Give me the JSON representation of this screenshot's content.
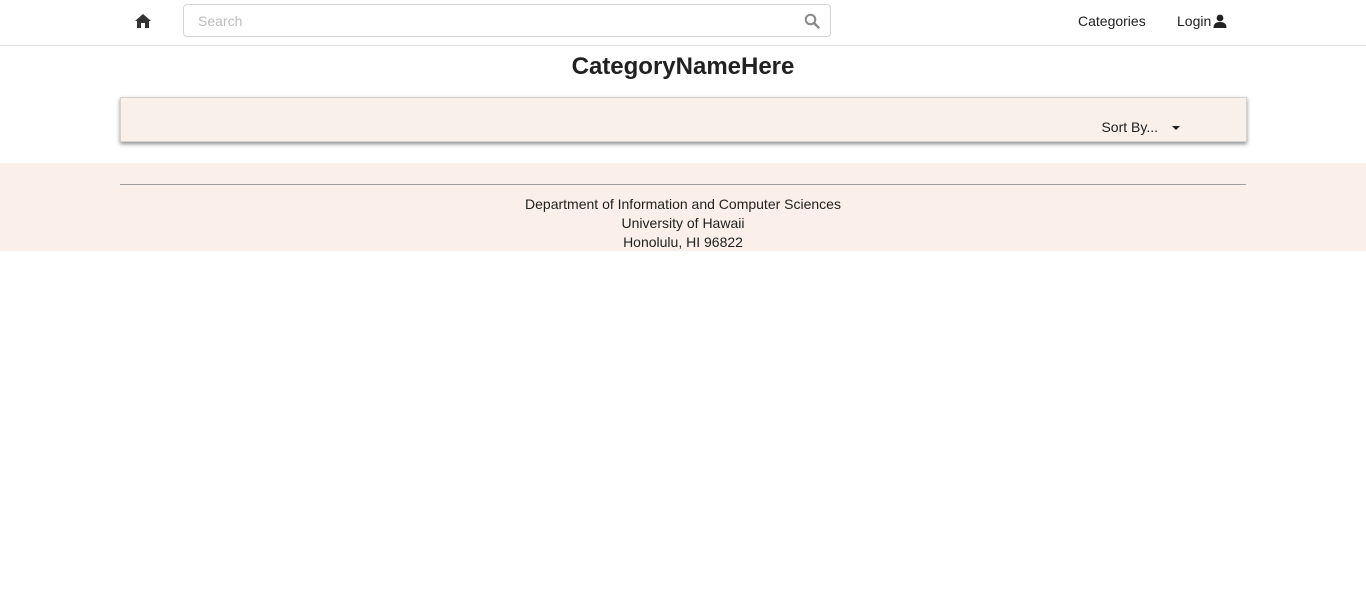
{
  "header": {
    "home_icon": "home-icon",
    "search": {
      "placeholder": "Search",
      "value": "",
      "icon": "search-icon"
    },
    "nav": {
      "categories_label": "Categories",
      "login_label": "Login",
      "login_icon": "user-icon"
    }
  },
  "main": {
    "title": "CategoryNameHere",
    "sort": {
      "label": "Sort By...",
      "icon": "caret-down-icon"
    }
  },
  "footer": {
    "line1": "Department of Information and Computer Sciences",
    "line2": "University of Hawaii",
    "line3": "Honolulu, HI 96822"
  },
  "colors": {
    "panel_background": "#f9f0ea",
    "footer_background": "#fbf0e9",
    "text": "#212121"
  }
}
